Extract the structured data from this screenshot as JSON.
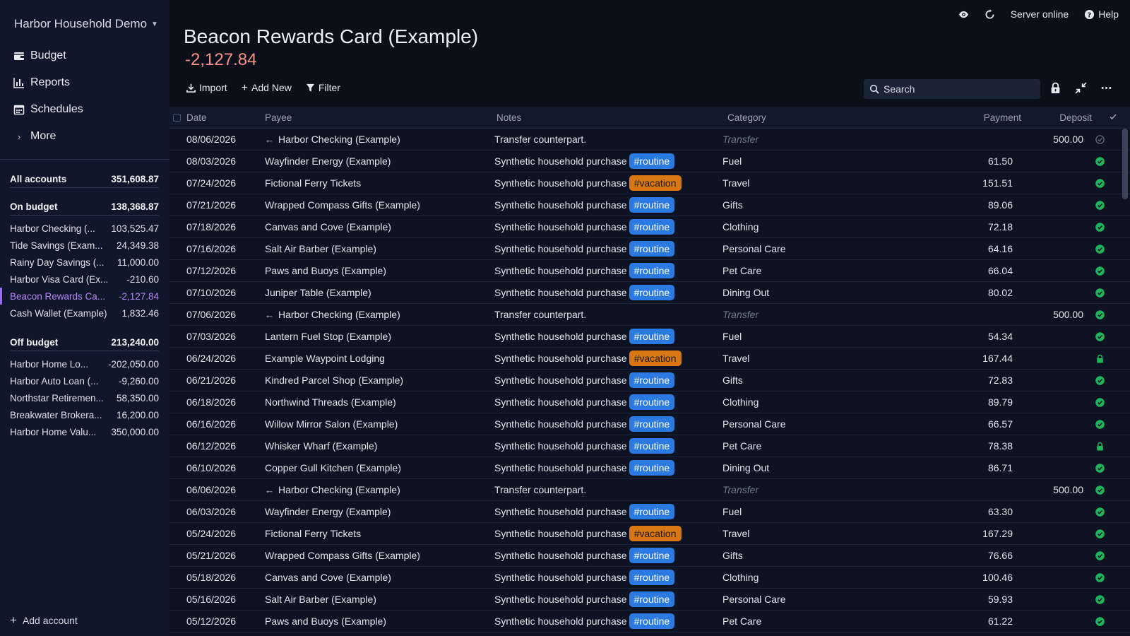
{
  "sidebar": {
    "budget_name": "Harbor Household Demo",
    "nav": [
      {
        "label": "Budget",
        "icon": "wallet-icon"
      },
      {
        "label": "Reports",
        "icon": "bar-chart-icon"
      },
      {
        "label": "Schedules",
        "icon": "calendar-icon"
      },
      {
        "label": "More",
        "icon": "chevron-right-icon"
      }
    ],
    "all_accounts": {
      "label": "All accounts",
      "balance": "351,608.87"
    },
    "on_budget": {
      "label": "On budget",
      "balance": "138,368.87"
    },
    "on_budget_accounts": [
      {
        "name": "Harbor Checking (...",
        "balance": "103,525.47"
      },
      {
        "name": "Tide Savings (Exam...",
        "balance": "24,349.38"
      },
      {
        "name": "Rainy Day Savings (...",
        "balance": "11,000.00"
      },
      {
        "name": "Harbor Visa Card (Ex...",
        "balance": "-210.60"
      },
      {
        "name": "Beacon Rewards Ca...",
        "balance": "-2,127.84",
        "selected": true
      },
      {
        "name": "Cash Wallet (Example)",
        "balance": "1,832.46"
      }
    ],
    "off_budget": {
      "label": "Off budget",
      "balance": "213,240.00"
    },
    "off_budget_accounts": [
      {
        "name": "Harbor Home Lo...",
        "balance": "-202,050.00"
      },
      {
        "name": "Harbor Auto Loan (...",
        "balance": "-9,260.00"
      },
      {
        "name": "Northstar Retiremen...",
        "balance": "58,350.00"
      },
      {
        "name": "Breakwater Brokera...",
        "balance": "16,200.00"
      },
      {
        "name": "Harbor Home Valu...",
        "balance": "350,000.00"
      }
    ],
    "add_account": "Add account"
  },
  "topbar": {
    "server_status": "Server online",
    "help": "Help"
  },
  "account": {
    "title": "Beacon Rewards Card (Example)",
    "balance": "-2,127.84"
  },
  "toolbar": {
    "import": "Import",
    "add_new": "Add New",
    "filter": "Filter",
    "search_placeholder": "Search"
  },
  "columns": {
    "date": "Date",
    "payee": "Payee",
    "notes": "Notes",
    "category": "Category",
    "payment": "Payment",
    "deposit": "Deposit"
  },
  "colors": {
    "routine_tag": "#2a7ae2",
    "vacation_tag": "#d97812",
    "negative_balance": "#f3938a",
    "selected_account": "#b287f6",
    "cleared": "#22b35e"
  },
  "transactions": [
    {
      "date": "08/06/2026",
      "payee": "Harbor Checking (Example)",
      "transfer": true,
      "notes": "Transfer counterpart.",
      "tag": "",
      "category": "Transfer",
      "payment": "",
      "deposit": "500.00",
      "status": "uncleared"
    },
    {
      "date": "08/03/2026",
      "payee": "Wayfinder Energy (Example)",
      "notes": "Synthetic household purchase",
      "tag": "#routine",
      "category": "Fuel",
      "payment": "61.50",
      "deposit": "",
      "status": "cleared"
    },
    {
      "date": "07/24/2026",
      "payee": "Fictional Ferry Tickets",
      "notes": "Synthetic household purchase",
      "tag": "#vacation",
      "category": "Travel",
      "payment": "151.51",
      "deposit": "",
      "status": "cleared"
    },
    {
      "date": "07/21/2026",
      "payee": "Wrapped Compass Gifts (Example)",
      "notes": "Synthetic household purchase",
      "tag": "#routine",
      "category": "Gifts",
      "payment": "89.06",
      "deposit": "",
      "status": "cleared"
    },
    {
      "date": "07/18/2026",
      "payee": "Canvas and Cove (Example)",
      "notes": "Synthetic household purchase",
      "tag": "#routine",
      "category": "Clothing",
      "payment": "72.18",
      "deposit": "",
      "status": "cleared"
    },
    {
      "date": "07/16/2026",
      "payee": "Salt Air Barber (Example)",
      "notes": "Synthetic household purchase",
      "tag": "#routine",
      "category": "Personal Care",
      "payment": "64.16",
      "deposit": "",
      "status": "cleared"
    },
    {
      "date": "07/12/2026",
      "payee": "Paws and Buoys (Example)",
      "notes": "Synthetic household purchase",
      "tag": "#routine",
      "category": "Pet Care",
      "payment": "66.04",
      "deposit": "",
      "status": "cleared"
    },
    {
      "date": "07/10/2026",
      "payee": "Juniper Table (Example)",
      "notes": "Synthetic household purchase",
      "tag": "#routine",
      "category": "Dining Out",
      "payment": "80.02",
      "deposit": "",
      "status": "cleared"
    },
    {
      "date": "07/06/2026",
      "payee": "Harbor Checking (Example)",
      "transfer": true,
      "notes": "Transfer counterpart.",
      "tag": "",
      "category": "Transfer",
      "payment": "",
      "deposit": "500.00",
      "status": "cleared"
    },
    {
      "date": "07/03/2026",
      "payee": "Lantern Fuel Stop (Example)",
      "notes": "Synthetic household purchase",
      "tag": "#routine",
      "category": "Fuel",
      "payment": "54.34",
      "deposit": "",
      "status": "cleared"
    },
    {
      "date": "06/24/2026",
      "payee": "Example Waypoint Lodging",
      "notes": "Synthetic household purchase",
      "tag": "#vacation",
      "category": "Travel",
      "payment": "167.44",
      "deposit": "",
      "status": "locked"
    },
    {
      "date": "06/21/2026",
      "payee": "Kindred Parcel Shop (Example)",
      "notes": "Synthetic household purchase",
      "tag": "#routine",
      "category": "Gifts",
      "payment": "72.83",
      "deposit": "",
      "status": "cleared"
    },
    {
      "date": "06/18/2026",
      "payee": "Northwind Threads (Example)",
      "notes": "Synthetic household purchase",
      "tag": "#routine",
      "category": "Clothing",
      "payment": "89.79",
      "deposit": "",
      "status": "cleared"
    },
    {
      "date": "06/16/2026",
      "payee": "Willow Mirror Salon (Example)",
      "notes": "Synthetic household purchase",
      "tag": "#routine",
      "category": "Personal Care",
      "payment": "66.57",
      "deposit": "",
      "status": "cleared"
    },
    {
      "date": "06/12/2026",
      "payee": "Whisker Wharf (Example)",
      "notes": "Synthetic household purchase",
      "tag": "#routine",
      "category": "Pet Care",
      "payment": "78.38",
      "deposit": "",
      "status": "locked"
    },
    {
      "date": "06/10/2026",
      "payee": "Copper Gull Kitchen (Example)",
      "notes": "Synthetic household purchase",
      "tag": "#routine",
      "category": "Dining Out",
      "payment": "86.71",
      "deposit": "",
      "status": "cleared"
    },
    {
      "date": "06/06/2026",
      "payee": "Harbor Checking (Example)",
      "transfer": true,
      "notes": "Transfer counterpart.",
      "tag": "",
      "category": "Transfer",
      "payment": "",
      "deposit": "500.00",
      "status": "cleared"
    },
    {
      "date": "06/03/2026",
      "payee": "Wayfinder Energy (Example)",
      "notes": "Synthetic household purchase",
      "tag": "#routine",
      "category": "Fuel",
      "payment": "63.30",
      "deposit": "",
      "status": "cleared"
    },
    {
      "date": "05/24/2026",
      "payee": "Fictional Ferry Tickets",
      "notes": "Synthetic household purchase",
      "tag": "#vacation",
      "category": "Travel",
      "payment": "167.29",
      "deposit": "",
      "status": "cleared"
    },
    {
      "date": "05/21/2026",
      "payee": "Wrapped Compass Gifts (Example)",
      "notes": "Synthetic household purchase",
      "tag": "#routine",
      "category": "Gifts",
      "payment": "76.66",
      "deposit": "",
      "status": "cleared"
    },
    {
      "date": "05/18/2026",
      "payee": "Canvas and Cove (Example)",
      "notes": "Synthetic household purchase",
      "tag": "#routine",
      "category": "Clothing",
      "payment": "100.46",
      "deposit": "",
      "status": "cleared"
    },
    {
      "date": "05/16/2026",
      "payee": "Salt Air Barber (Example)",
      "notes": "Synthetic household purchase",
      "tag": "#routine",
      "category": "Personal Care",
      "payment": "59.93",
      "deposit": "",
      "status": "cleared"
    },
    {
      "date": "05/12/2026",
      "payee": "Paws and Buoys (Example)",
      "notes": "Synthetic household purchase",
      "tag": "#routine",
      "category": "Pet Care",
      "payment": "61.22",
      "deposit": "",
      "status": "cleared"
    }
  ]
}
